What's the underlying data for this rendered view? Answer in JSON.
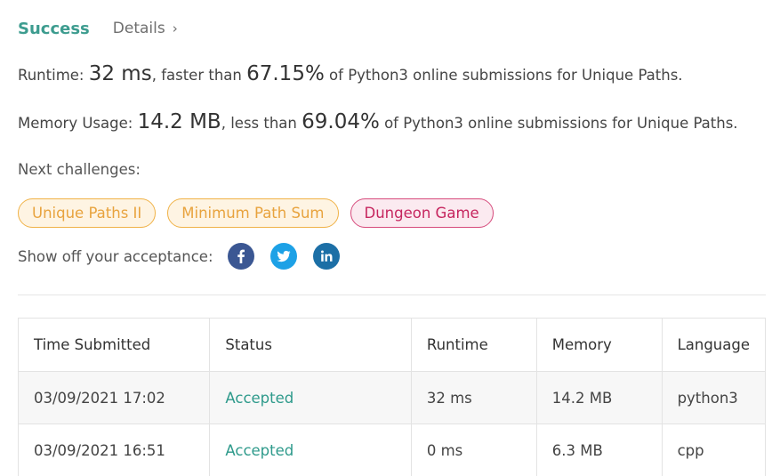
{
  "header": {
    "status": "Success",
    "details_label": "Details"
  },
  "runtime": {
    "label": "Runtime: ",
    "value": "32 ms",
    "mid": ", faster than ",
    "percent": "67.15%",
    "suffix": " of Python3 online submissions for Unique Paths."
  },
  "memory": {
    "label": "Memory Usage: ",
    "value": "14.2 MB",
    "mid": ", less than ",
    "percent": "69.04%",
    "suffix": " of Python3 online submissions for Unique Paths."
  },
  "next": {
    "label": "Next challenges:",
    "items": [
      {
        "label": "Unique Paths II",
        "difficulty": "medium"
      },
      {
        "label": "Minimum Path Sum",
        "difficulty": "medium"
      },
      {
        "label": "Dungeon Game",
        "difficulty": "hard"
      }
    ]
  },
  "share": {
    "label": "Show off your acceptance:",
    "icons": [
      "facebook-icon",
      "twitter-icon",
      "linkedin-icon"
    ]
  },
  "table": {
    "headers": [
      "Time Submitted",
      "Status",
      "Runtime",
      "Memory",
      "Language"
    ],
    "rows": [
      [
        "03/09/2021 17:02",
        "Accepted",
        "32 ms",
        "14.2 MB",
        "python3"
      ],
      [
        "03/09/2021 16:51",
        "Accepted",
        "0 ms",
        "6.3 MB",
        "cpp"
      ]
    ]
  },
  "colors": {
    "success": "#3d9c8f",
    "medium_tag": "#e8a33e",
    "hard_tag": "#c6265f",
    "facebook": "#3b5793",
    "twitter": "#1da1e6",
    "linkedin": "#1c6fa6"
  }
}
